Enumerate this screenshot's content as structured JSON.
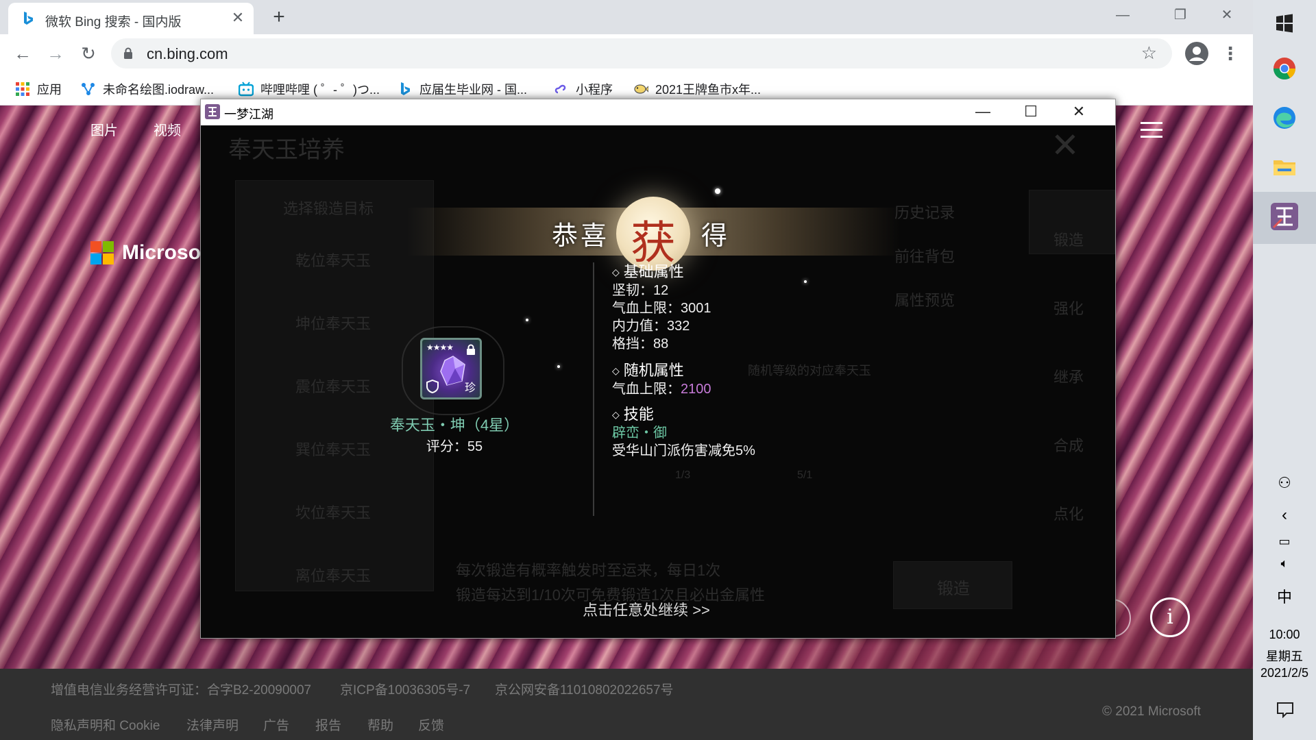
{
  "browser": {
    "tab_title": "微软 Bing 搜索 - 国内版",
    "tab_close": "✕",
    "new_tab": "+",
    "window_controls": {
      "minimize": "—",
      "restore": "❐",
      "close": "✕"
    },
    "url": "cn.bing.com",
    "bookmarks": [
      {
        "label": "应用",
        "icon": "apps-grid-icon"
      },
      {
        "label": "未命名绘图.iodraw...",
        "icon": "iodraw-icon"
      },
      {
        "label": "哔哩哔哩 ( ゜- ゜)つ...",
        "icon": "bilibili-icon"
      },
      {
        "label": "应届生毕业网 - 国...",
        "icon": "bing-icon"
      },
      {
        "label": "小程序",
        "icon": "link-icon"
      },
      {
        "label": "2021王牌鱼市x年...",
        "icon": "fish-icon"
      }
    ]
  },
  "bing": {
    "nav": [
      "图片",
      "视频"
    ],
    "logo_text": "Microsoft",
    "info_glyph": "i",
    "footer": {
      "row1": [
        "增值电信业务经营许可证：合字B2-20090007",
        "京ICP备10036305号-7",
        "京公网安备11010802022657号"
      ],
      "row2": [
        "隐私声明和 Cookie",
        "法律声明",
        "广告",
        "报告",
        "帮助",
        "反馈"
      ],
      "copyright": "© 2021 Microsoft"
    }
  },
  "game": {
    "window_title": "一梦江湖",
    "background_ui": {
      "title": "奉天玉培养",
      "select_target": "选择锻造目标",
      "list": [
        "乾位奉天玉",
        "坤位奉天玉",
        "震位奉天玉",
        "巽位奉天玉",
        "坎位奉天玉",
        "离位奉天玉"
      ],
      "right_links": [
        "历史记录",
        "前往背包",
        "属性预览"
      ],
      "right_tabs": [
        "锻造",
        "强化",
        "继承",
        "合成",
        "点化"
      ],
      "center_lines": [
        "每次锻造有概率触发时至运来，每日1次",
        "锻造每达到1/10次可免费锻造1次且必出金属性"
      ],
      "forge_button": "锻造",
      "counts": [
        "1/3",
        "5/1"
      ],
      "random_line": "随机等级的对应奉天玉"
    },
    "banner": {
      "left": "恭喜",
      "center": "获",
      "right": "得"
    },
    "item": {
      "name": "奉天玉・坤（4星）",
      "score": "评分：55",
      "stars": "★★★★",
      "rarity": "珍"
    },
    "sections": {
      "base_title": "基础属性",
      "base_attrs": [
        "坚韧：12",
        "气血上限：3001",
        "内力值：332",
        "格挡：88"
      ],
      "random_title": "随机属性",
      "random_attr_label": "气血上限：",
      "random_attr_value": "2100",
      "skill_title": "技能",
      "skill_name": "辟峦・御",
      "skill_desc": "受华山门派伤害减免5%"
    },
    "continue_hint": "点击任意处继续 >>"
  },
  "taskbar": {
    "ime": "中",
    "time": "10:00",
    "weekday": "星期五",
    "date": "2021/2/5"
  },
  "colors": {
    "item_name": "#7fcbb1",
    "random_value": "#c77bd9",
    "skill_name": "#6dc8a5",
    "banner_char": "#b0301e"
  }
}
